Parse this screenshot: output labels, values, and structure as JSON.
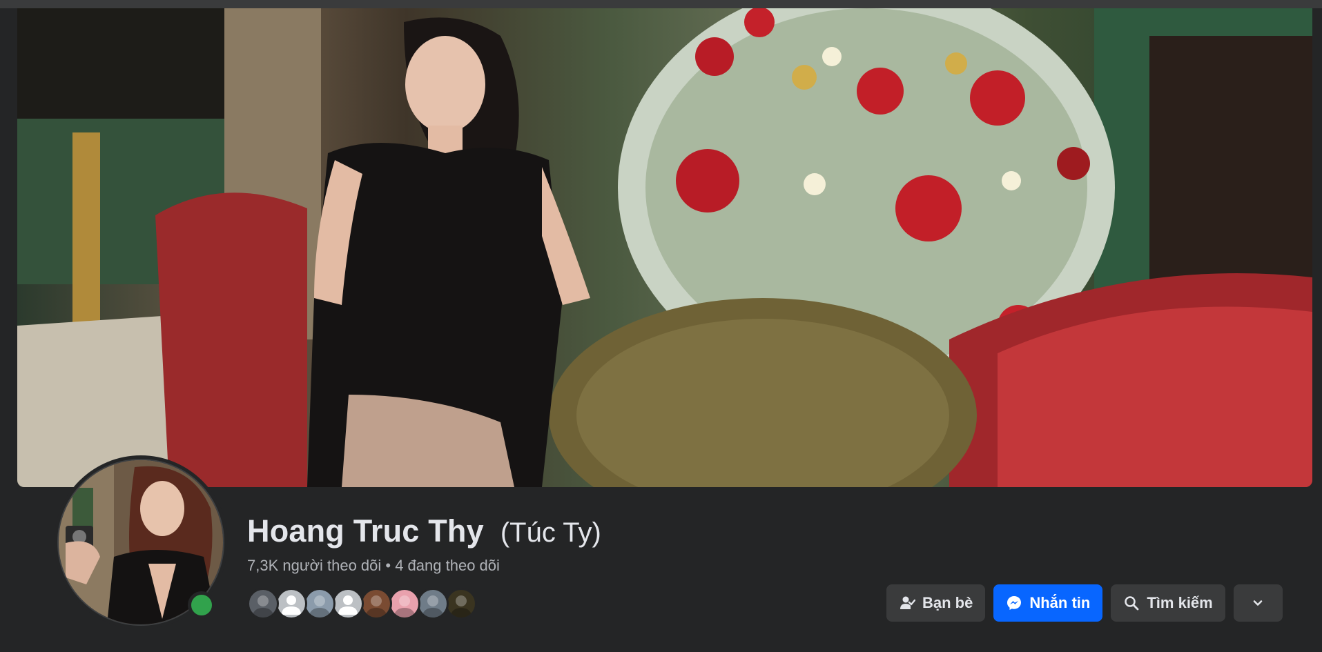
{
  "profile": {
    "name": "Hoang Truc Thy",
    "alternate_name": "(Túc Ty)",
    "followers_line": "7,3K người theo dõi • 4 đang theo dõi",
    "online": true
  },
  "cover_photo": {
    "description_icon": "cover-photo"
  },
  "mutual_friends": [
    {
      "avatar": "photo",
      "color": "#5a5f66"
    },
    {
      "avatar": "default-silhouette",
      "color": "#bcc0c4"
    },
    {
      "avatar": "photo",
      "color": "#8b9bab"
    },
    {
      "avatar": "default-silhouette",
      "color": "#bcc0c4"
    },
    {
      "avatar": "photo",
      "color": "#7a4b32"
    },
    {
      "avatar": "photo",
      "color": "#e9a1ad"
    },
    {
      "avatar": "photo",
      "color": "#6f7c88"
    },
    {
      "avatar": "photo",
      "color": "#3a3420"
    }
  ],
  "actions": {
    "friends_label": "Bạn bè",
    "message_label": "Nhắn tin",
    "search_label": "Tìm kiếm"
  },
  "colors": {
    "background": "#242526",
    "button": "#3a3b3c",
    "primary": "#0866ff",
    "online": "#31a24c"
  }
}
